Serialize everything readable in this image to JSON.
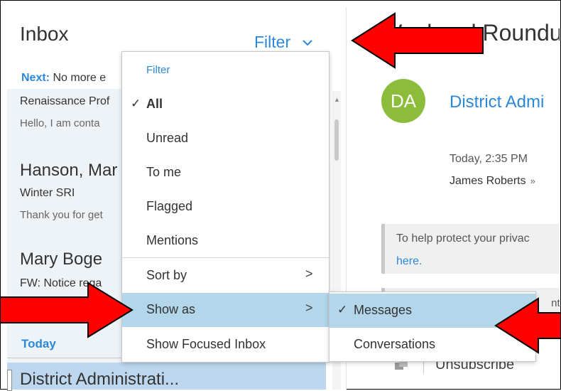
{
  "inbox": {
    "title": "Inbox",
    "filter_label": "Filter",
    "next_label": "Next:",
    "next_text": "No more e",
    "messages": [
      {
        "sender": "Renaissance Prof",
        "preview": "Hello,  I am conta"
      },
      {
        "sender": "Hanson, Mar",
        "subject": "Winter SRI",
        "preview": "Thank you for get"
      },
      {
        "sender": "Mary Boge",
        "subject": "FW: Notice rega"
      }
    ],
    "group_today": "Today",
    "selected_sender": "District Administrati..."
  },
  "filter_menu": {
    "header": "Filter",
    "checkmark": "✓",
    "arrow": ">",
    "items": [
      {
        "label": "All"
      },
      {
        "label": "Unread"
      },
      {
        "label": "To me"
      },
      {
        "label": "Flagged"
      },
      {
        "label": "Mentions"
      },
      {
        "label": "Sort by"
      },
      {
        "label": "Show as"
      },
      {
        "label": "Show Focused Inbox"
      }
    ]
  },
  "show_as_menu": {
    "items": [
      {
        "label": "Messages"
      },
      {
        "label": "Conversations"
      }
    ]
  },
  "reading_pane": {
    "subject": "Weekend Roundu",
    "avatar_initials": "DA",
    "sender": "District Admi",
    "time": "Today, 2:35 PM",
    "recipient": "James Roberts",
    "recipient_chevron": "»",
    "privacy_text": "To help protect your privac",
    "privacy_link": "here.",
    "fragment_text": "nt fr",
    "unsubscribe": "Unsubscribe"
  },
  "colors": {
    "accent": "#2b88d8",
    "menu_highlight": "#b3d6ea",
    "avatar": "#8bbd3b",
    "annotation_arrow": "#ff0000"
  },
  "icons": {
    "filter_chevron": "chevron-down-icon",
    "menu_check": "checkmark-icon",
    "submenu_arrow": "chevron-right-icon",
    "unsubscribe": "unsubscribe-icon",
    "annotation": "red-arrow-icon"
  }
}
